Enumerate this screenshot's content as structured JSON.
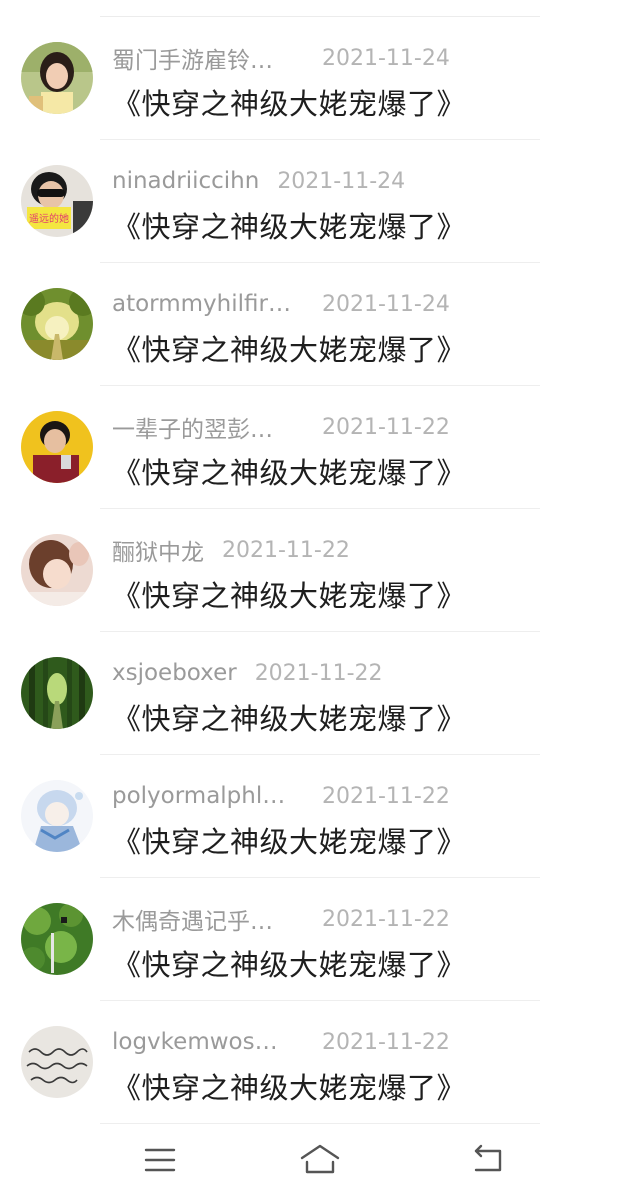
{
  "comments": [
    {
      "username": "蜀门手游雇铃…",
      "date": "2021-11-24",
      "text": "《快穿之神级大姥宠爆了》",
      "avatar": "girl-avatar-icon",
      "truncated": true
    },
    {
      "username": "ninadriiccihn",
      "date": "2021-11-24",
      "text": "《快穿之神级大姥宠爆了》",
      "avatar": "boy-sunglasses-avatar-icon",
      "avatar_text": "遥远的她",
      "truncated": false
    },
    {
      "username": "atormmyhilfir…",
      "date": "2021-11-24",
      "text": "《快穿之神级大姥宠爆了》",
      "avatar": "forest-path-avatar-icon",
      "truncated": true
    },
    {
      "username": "一辈子的翌彭…",
      "date": "2021-11-22",
      "text": "《快穿之神级大姥宠爆了》",
      "avatar": "boy-yellow-avatar-icon",
      "truncated": true
    },
    {
      "username": "酾狱中龙",
      "date": "2021-11-22",
      "text": "《快穿之神级大姥宠爆了》",
      "avatar": "girl-portrait-avatar-icon",
      "truncated": false
    },
    {
      "username": "xsjoeboxer",
      "date": "2021-11-22",
      "text": "《快穿之神级大姥宠爆了》",
      "avatar": "green-forest-avatar-icon",
      "truncated": false
    },
    {
      "username": "polyormalphl…",
      "date": "2021-11-22",
      "text": "《快穿之神级大姥宠爆了》",
      "avatar": "anime-boy-avatar-icon",
      "truncated": true
    },
    {
      "username": "木偶奇遇记乎…",
      "date": "2021-11-22",
      "text": "《快穿之神级大姥宠爆了》",
      "avatar": "leaves-avatar-icon",
      "truncated": true
    },
    {
      "username": "logvkemwos…",
      "date": "2021-11-22",
      "text": "《快穿之神级大姥宠爆了》",
      "avatar": "handwriting-avatar-icon",
      "truncated": true
    }
  ],
  "navbar": {
    "menu_icon": "menu-icon",
    "home_icon": "home-icon",
    "back_icon": "back-icon"
  },
  "colors": {
    "username": "#9a9a9a",
    "date": "#b4b4b4",
    "text": "#1e1e1e",
    "divider": "#eeeeee",
    "nav_icon": "#555555"
  }
}
